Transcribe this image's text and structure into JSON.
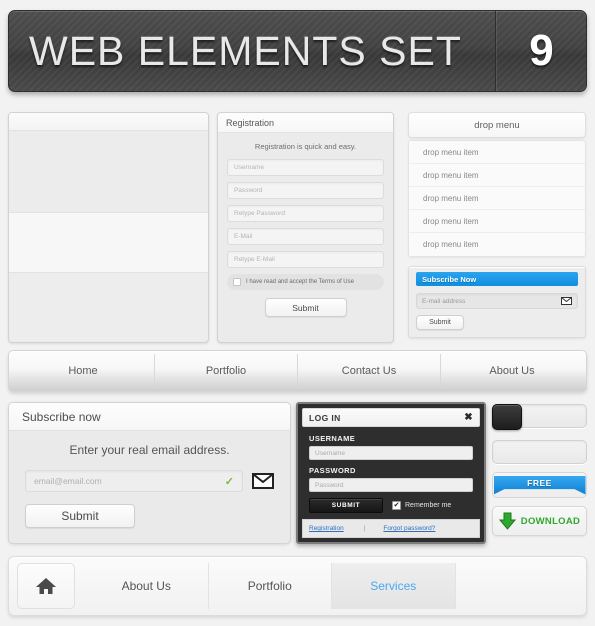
{
  "banner": {
    "title": "WEB ELEMENTS SET",
    "number": "9"
  },
  "content_box": {
    "bands": [
      "",
      "",
      "",
      ""
    ]
  },
  "registration": {
    "title": "Registration",
    "subtitle": "Registration is quick and easy.",
    "fields": [
      {
        "placeholder": "Username"
      },
      {
        "placeholder": "Password"
      },
      {
        "placeholder": "Retype Password"
      },
      {
        "placeholder": "E-Mail"
      },
      {
        "placeholder": "Retype E-Mail"
      }
    ],
    "terms_label": "I have read and accept the Terms of Use",
    "terms_checked": false,
    "submit_label": "Submit"
  },
  "drop_menu": {
    "header": "drop menu",
    "items": [
      {
        "label": "drop menu item"
      },
      {
        "label": "drop menu item"
      },
      {
        "label": "drop menu item"
      },
      {
        "label": "drop menu item"
      },
      {
        "label": "drop menu item"
      }
    ]
  },
  "subscribe_small": {
    "bar_title": "Subscribe Now",
    "email_placeholder": "E-mail address",
    "submit_label": "Submit",
    "bar_color": "#1a96e6",
    "mail_icon": "envelope-icon"
  },
  "navbar": {
    "items": [
      {
        "label": "Home"
      },
      {
        "label": "Portfolio"
      },
      {
        "label": "Contact Us"
      },
      {
        "label": "About Us"
      }
    ]
  },
  "subscribe_large": {
    "title": "Subscribe now",
    "subtitle": "Enter your real email address.",
    "email_placeholder": "email@email.com",
    "valid_mark": "✓",
    "valid_color": "#7fb83c",
    "submit_label": "Submit",
    "mail_icon": "envelope-icon"
  },
  "login": {
    "title": "LOG IN",
    "close_label": "✖",
    "username_label": "USERNAME",
    "username_placeholder": "Username",
    "password_label": "PASSWORD",
    "password_placeholder": "Password",
    "submit_label": "SUBMIT",
    "remember_label": "Remember me",
    "remember_checked": true,
    "check_mark": "✔",
    "registration_link": "Registration",
    "separator": "|",
    "forgot_link": "Forgot password?",
    "link_color": "#2f6fbf"
  },
  "widgets": {
    "toggle": {
      "state": "off"
    },
    "blank_panel": {
      "label": ""
    },
    "ribbon": {
      "label": "FREE",
      "color": "#1b8ede"
    },
    "download": {
      "label": "DOWNLOAD",
      "color": "#2fa82f",
      "icon": "down-arrow-icon"
    }
  },
  "tabbar": {
    "home_icon": "home-icon",
    "tabs": [
      {
        "label": "About Us",
        "active": false
      },
      {
        "label": "Portfolio",
        "active": false
      },
      {
        "label": "Services",
        "active": true
      },
      {
        "label": "",
        "active": false
      }
    ]
  }
}
